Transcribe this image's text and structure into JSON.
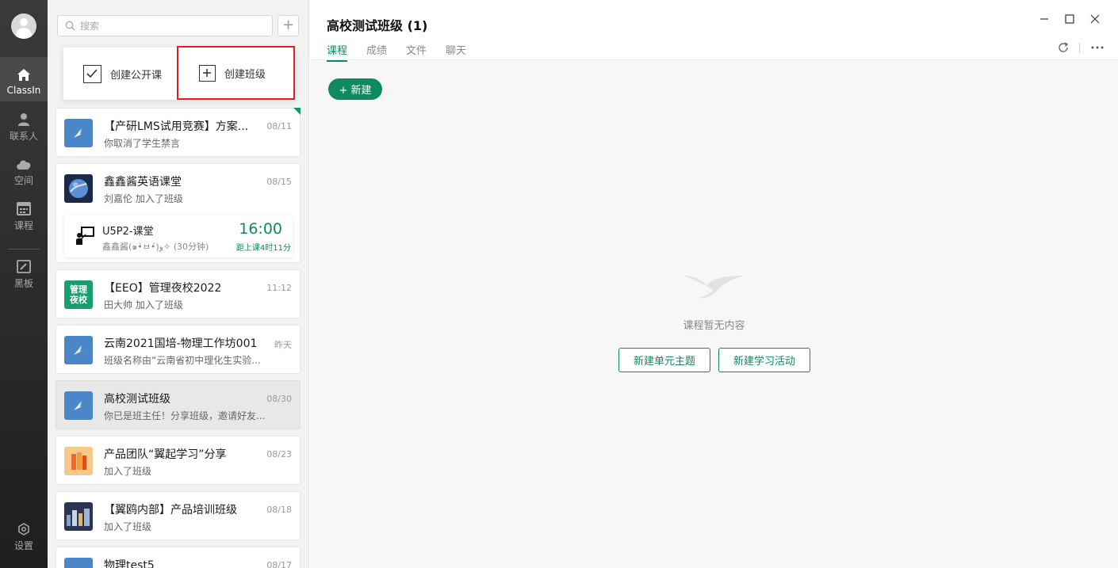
{
  "nav": {
    "items": [
      {
        "label": "ClassIn",
        "icon": "home-icon"
      },
      {
        "label": "联系人",
        "icon": "contacts-icon"
      },
      {
        "label": "空间",
        "icon": "cloud-icon"
      },
      {
        "label": "课程",
        "icon": "calendar-icon"
      },
      {
        "label": "黑板",
        "icon": "blackboard-icon"
      },
      {
        "label": "设置",
        "icon": "settings-icon"
      }
    ]
  },
  "search": {
    "placeholder": "搜索"
  },
  "add_button": "+",
  "create_menu": {
    "public_course": "创建公开课",
    "create_class": "创建班级"
  },
  "conversations": [
    {
      "title": "【产研LMS试用竞赛】方案...",
      "date": "08/11",
      "subtitle": "你取消了学生禁言"
    },
    {
      "title": "鑫鑫酱英语课堂",
      "date": "08/15",
      "subtitle": "刘嘉伦 加入了班级",
      "lesson": {
        "name": "U5P2-课堂",
        "teacher": "鑫鑫酱(๑•̀ㅂ•́)و✧ (30分钟)",
        "time": "16:00",
        "countdown": "距上课4时11分"
      }
    },
    {
      "title": "【EEO】管理夜校2022",
      "date": "11:12",
      "subtitle": "田大帅 加入了班级",
      "icon_text": "管理\n夜校"
    },
    {
      "title": "云南2021国培-物理工作坊001",
      "date": "昨天",
      "subtitle": "班级名称由“云南省初中理化生实验..."
    },
    {
      "title": "高校测试班级",
      "date": "08/30",
      "subtitle": "你已是班主任！分享班级，邀请好友..."
    },
    {
      "title": "产品团队“翼起学习”分享",
      "date": "08/23",
      "subtitle": " 加入了班级"
    },
    {
      "title": "【翼鸥内部】产品培训班级",
      "date": "08/18",
      "subtitle": " 加入了班级"
    },
    {
      "title": "物理test5",
      "date": "08/17",
      "subtitle": ""
    }
  ],
  "main": {
    "title": "高校测试班级 (1)",
    "tabs": [
      "课程",
      "成绩",
      "文件",
      "聊天"
    ],
    "new_button": "+ 新建",
    "empty_text": "课程暂无内容",
    "new_unit_button": "新建单元主题",
    "new_activity_button": "新建学习活动"
  },
  "colors": {
    "accent": "#0f8a5f",
    "highlight_border": "#e02020"
  }
}
